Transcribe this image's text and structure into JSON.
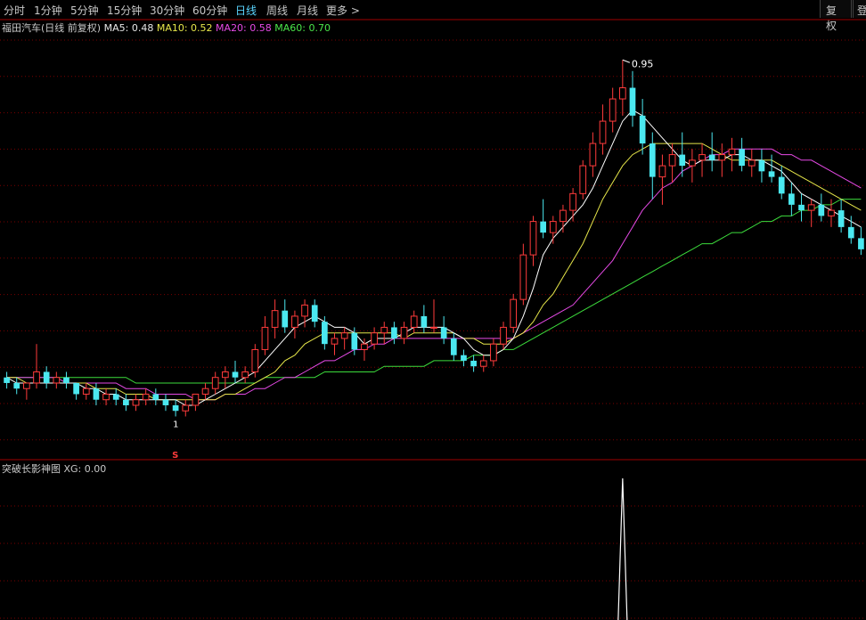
{
  "toolbar": {
    "periods": [
      "分时",
      "1分钟",
      "5分钟",
      "15分钟",
      "30分钟",
      "60分钟",
      "日线",
      "周线",
      "月线",
      "更多 >"
    ],
    "active": "日线",
    "restore_button": "复权",
    "login_button": "登"
  },
  "main_chart": {
    "stock_name": "福田汽车(日线 前复权)",
    "ma5_label": "MA5:",
    "ma5_value": "0.48",
    "ma10_label": "MA10:",
    "ma10_value": "0.52",
    "ma20_label": "MA20:",
    "ma20_value": "0.58",
    "ma60_label": "MA60:",
    "ma60_value": "0.70",
    "high_marker": "0.95",
    "low_marker_1": "1",
    "signal_marker": "S"
  },
  "indicator": {
    "name": "突破长影神图",
    "xg_label": "XG:",
    "xg_value": "0.00"
  },
  "colors": {
    "up": "#ff3b3b",
    "down": "#4be8f0",
    "ma5": "#ffffff",
    "ma10": "#e6e64a",
    "ma20": "#e64ae6",
    "ma60": "#3cdc3c",
    "grid": "#7a0000",
    "active_tab": "#5ad5ff"
  },
  "chart_data": {
    "type": "candlestick",
    "candles": [
      [
        0.38,
        0.39,
        0.36,
        0.37
      ],
      [
        0.37,
        0.38,
        0.35,
        0.36
      ],
      [
        0.36,
        0.37,
        0.34,
        0.37
      ],
      [
        0.37,
        0.44,
        0.36,
        0.39
      ],
      [
        0.39,
        0.4,
        0.36,
        0.37
      ],
      [
        0.37,
        0.39,
        0.36,
        0.38
      ],
      [
        0.38,
        0.39,
        0.36,
        0.37
      ],
      [
        0.37,
        0.37,
        0.34,
        0.35
      ],
      [
        0.35,
        0.37,
        0.34,
        0.36
      ],
      [
        0.36,
        0.37,
        0.33,
        0.34
      ],
      [
        0.34,
        0.36,
        0.33,
        0.35
      ],
      [
        0.35,
        0.36,
        0.33,
        0.34
      ],
      [
        0.34,
        0.35,
        0.32,
        0.33
      ],
      [
        0.33,
        0.35,
        0.32,
        0.34
      ],
      [
        0.34,
        0.36,
        0.33,
        0.35
      ],
      [
        0.35,
        0.36,
        0.33,
        0.34
      ],
      [
        0.34,
        0.35,
        0.32,
        0.33
      ],
      [
        0.33,
        0.34,
        0.31,
        0.32
      ],
      [
        0.32,
        0.34,
        0.31,
        0.33
      ],
      [
        0.33,
        0.35,
        0.32,
        0.35
      ],
      [
        0.35,
        0.37,
        0.34,
        0.36
      ],
      [
        0.36,
        0.39,
        0.35,
        0.38
      ],
      [
        0.38,
        0.4,
        0.36,
        0.39
      ],
      [
        0.39,
        0.41,
        0.37,
        0.38
      ],
      [
        0.38,
        0.4,
        0.37,
        0.39
      ],
      [
        0.39,
        0.44,
        0.38,
        0.43
      ],
      [
        0.43,
        0.49,
        0.42,
        0.47
      ],
      [
        0.47,
        0.52,
        0.45,
        0.5
      ],
      [
        0.5,
        0.52,
        0.46,
        0.47
      ],
      [
        0.47,
        0.5,
        0.45,
        0.49
      ],
      [
        0.49,
        0.52,
        0.47,
        0.51
      ],
      [
        0.51,
        0.52,
        0.47,
        0.48
      ],
      [
        0.48,
        0.49,
        0.43,
        0.44
      ],
      [
        0.44,
        0.46,
        0.42,
        0.45
      ],
      [
        0.45,
        0.47,
        0.43,
        0.46
      ],
      [
        0.46,
        0.47,
        0.42,
        0.43
      ],
      [
        0.43,
        0.45,
        0.41,
        0.44
      ],
      [
        0.44,
        0.47,
        0.43,
        0.46
      ],
      [
        0.46,
        0.48,
        0.44,
        0.47
      ],
      [
        0.47,
        0.48,
        0.44,
        0.45
      ],
      [
        0.45,
        0.48,
        0.44,
        0.47
      ],
      [
        0.47,
        0.5,
        0.46,
        0.49
      ],
      [
        0.49,
        0.51,
        0.46,
        0.47
      ],
      [
        0.47,
        0.52,
        0.46,
        0.47
      ],
      [
        0.47,
        0.49,
        0.44,
        0.45
      ],
      [
        0.45,
        0.46,
        0.41,
        0.42
      ],
      [
        0.42,
        0.43,
        0.4,
        0.41
      ],
      [
        0.41,
        0.42,
        0.39,
        0.4
      ],
      [
        0.4,
        0.42,
        0.39,
        0.41
      ],
      [
        0.41,
        0.45,
        0.4,
        0.44
      ],
      [
        0.44,
        0.48,
        0.43,
        0.47
      ],
      [
        0.47,
        0.53,
        0.46,
        0.52
      ],
      [
        0.52,
        0.62,
        0.51,
        0.6
      ],
      [
        0.6,
        0.67,
        0.58,
        0.66
      ],
      [
        0.66,
        0.7,
        0.63,
        0.64
      ],
      [
        0.64,
        0.67,
        0.62,
        0.66
      ],
      [
        0.66,
        0.69,
        0.64,
        0.68
      ],
      [
        0.68,
        0.72,
        0.66,
        0.71
      ],
      [
        0.71,
        0.77,
        0.7,
        0.76
      ],
      [
        0.76,
        0.82,
        0.74,
        0.8
      ],
      [
        0.8,
        0.87,
        0.78,
        0.84
      ],
      [
        0.84,
        0.9,
        0.82,
        0.88
      ],
      [
        0.88,
        0.95,
        0.85,
        0.9
      ],
      [
        0.9,
        0.93,
        0.83,
        0.85
      ],
      [
        0.85,
        0.88,
        0.78,
        0.8
      ],
      [
        0.8,
        0.82,
        0.7,
        0.74
      ],
      [
        0.74,
        0.78,
        0.69,
        0.76
      ],
      [
        0.76,
        0.8,
        0.73,
        0.78
      ],
      [
        0.78,
        0.82,
        0.74,
        0.76
      ],
      [
        0.76,
        0.79,
        0.73,
        0.77
      ],
      [
        0.77,
        0.8,
        0.74,
        0.78
      ],
      [
        0.78,
        0.82,
        0.75,
        0.77
      ],
      [
        0.77,
        0.8,
        0.74,
        0.78
      ],
      [
        0.78,
        0.81,
        0.75,
        0.79
      ],
      [
        0.79,
        0.81,
        0.75,
        0.76
      ],
      [
        0.76,
        0.79,
        0.74,
        0.77
      ],
      [
        0.77,
        0.79,
        0.73,
        0.75
      ],
      [
        0.75,
        0.78,
        0.73,
        0.74
      ],
      [
        0.74,
        0.76,
        0.7,
        0.71
      ],
      [
        0.71,
        0.73,
        0.67,
        0.69
      ],
      [
        0.69,
        0.71,
        0.66,
        0.68
      ],
      [
        0.68,
        0.7,
        0.65,
        0.69
      ],
      [
        0.69,
        0.71,
        0.66,
        0.67
      ],
      [
        0.67,
        0.7,
        0.65,
        0.68
      ],
      [
        0.68,
        0.7,
        0.64,
        0.65
      ],
      [
        0.65,
        0.67,
        0.62,
        0.63
      ],
      [
        0.63,
        0.65,
        0.6,
        0.61
      ]
    ],
    "ma5": [
      0.38,
      0.37,
      0.37,
      0.37,
      0.37,
      0.37,
      0.37,
      0.37,
      0.36,
      0.36,
      0.35,
      0.35,
      0.34,
      0.34,
      0.34,
      0.34,
      0.34,
      0.34,
      0.33,
      0.33,
      0.34,
      0.35,
      0.36,
      0.37,
      0.38,
      0.39,
      0.41,
      0.43,
      0.45,
      0.47,
      0.48,
      0.49,
      0.48,
      0.47,
      0.47,
      0.46,
      0.44,
      0.45,
      0.45,
      0.45,
      0.46,
      0.47,
      0.47,
      0.47,
      0.47,
      0.46,
      0.45,
      0.43,
      0.42,
      0.42,
      0.43,
      0.45,
      0.49,
      0.54,
      0.6,
      0.63,
      0.65,
      0.67,
      0.69,
      0.72,
      0.76,
      0.8,
      0.84,
      0.86,
      0.85,
      0.83,
      0.81,
      0.79,
      0.77,
      0.76,
      0.77,
      0.77,
      0.77,
      0.78,
      0.78,
      0.77,
      0.77,
      0.76,
      0.75,
      0.73,
      0.71,
      0.7,
      0.69,
      0.68,
      0.67,
      0.66,
      0.65
    ],
    "ma10": [
      0.38,
      0.38,
      0.37,
      0.37,
      0.37,
      0.37,
      0.37,
      0.37,
      0.37,
      0.36,
      0.36,
      0.36,
      0.35,
      0.35,
      0.35,
      0.34,
      0.34,
      0.34,
      0.34,
      0.34,
      0.34,
      0.34,
      0.35,
      0.35,
      0.36,
      0.37,
      0.38,
      0.39,
      0.41,
      0.42,
      0.44,
      0.45,
      0.46,
      0.46,
      0.46,
      0.46,
      0.46,
      0.46,
      0.46,
      0.46,
      0.45,
      0.46,
      0.46,
      0.46,
      0.46,
      0.46,
      0.45,
      0.45,
      0.44,
      0.44,
      0.44,
      0.45,
      0.46,
      0.48,
      0.51,
      0.53,
      0.56,
      0.59,
      0.62,
      0.66,
      0.7,
      0.73,
      0.76,
      0.78,
      0.79,
      0.8,
      0.8,
      0.8,
      0.8,
      0.8,
      0.8,
      0.79,
      0.78,
      0.77,
      0.77,
      0.77,
      0.77,
      0.77,
      0.76,
      0.75,
      0.74,
      0.73,
      0.72,
      0.71,
      0.7,
      0.69,
      0.68
    ],
    "ma20": [
      0.38,
      0.38,
      0.38,
      0.38,
      0.38,
      0.38,
      0.37,
      0.37,
      0.37,
      0.37,
      0.37,
      0.37,
      0.36,
      0.36,
      0.36,
      0.35,
      0.35,
      0.35,
      0.35,
      0.34,
      0.34,
      0.34,
      0.35,
      0.35,
      0.35,
      0.36,
      0.36,
      0.37,
      0.38,
      0.38,
      0.39,
      0.4,
      0.41,
      0.41,
      0.42,
      0.43,
      0.43,
      0.44,
      0.44,
      0.45,
      0.45,
      0.45,
      0.45,
      0.45,
      0.45,
      0.45,
      0.45,
      0.45,
      0.45,
      0.45,
      0.45,
      0.45,
      0.46,
      0.47,
      0.48,
      0.49,
      0.5,
      0.51,
      0.53,
      0.55,
      0.57,
      0.59,
      0.62,
      0.65,
      0.68,
      0.7,
      0.72,
      0.73,
      0.75,
      0.76,
      0.77,
      0.78,
      0.78,
      0.79,
      0.79,
      0.79,
      0.79,
      0.79,
      0.78,
      0.78,
      0.77,
      0.77,
      0.76,
      0.75,
      0.74,
      0.73,
      0.72
    ],
    "ma60": [
      0.38,
      0.38,
      0.38,
      0.38,
      0.38,
      0.38,
      0.38,
      0.38,
      0.38,
      0.38,
      0.38,
      0.38,
      0.38,
      0.37,
      0.37,
      0.37,
      0.37,
      0.37,
      0.37,
      0.37,
      0.37,
      0.37,
      0.37,
      0.37,
      0.37,
      0.37,
      0.38,
      0.38,
      0.38,
      0.38,
      0.38,
      0.38,
      0.39,
      0.39,
      0.39,
      0.39,
      0.39,
      0.39,
      0.4,
      0.4,
      0.4,
      0.4,
      0.4,
      0.41,
      0.41,
      0.41,
      0.41,
      0.42,
      0.42,
      0.42,
      0.43,
      0.43,
      0.44,
      0.45,
      0.46,
      0.47,
      0.48,
      0.49,
      0.5,
      0.51,
      0.52,
      0.53,
      0.54,
      0.55,
      0.56,
      0.57,
      0.58,
      0.59,
      0.6,
      0.61,
      0.62,
      0.62,
      0.63,
      0.64,
      0.64,
      0.65,
      0.66,
      0.66,
      0.67,
      0.67,
      0.68,
      0.68,
      0.69,
      0.69,
      0.7,
      0.7,
      0.7
    ],
    "xg_spike_index": 62,
    "ylim": [
      0.25,
      1.0
    ]
  }
}
